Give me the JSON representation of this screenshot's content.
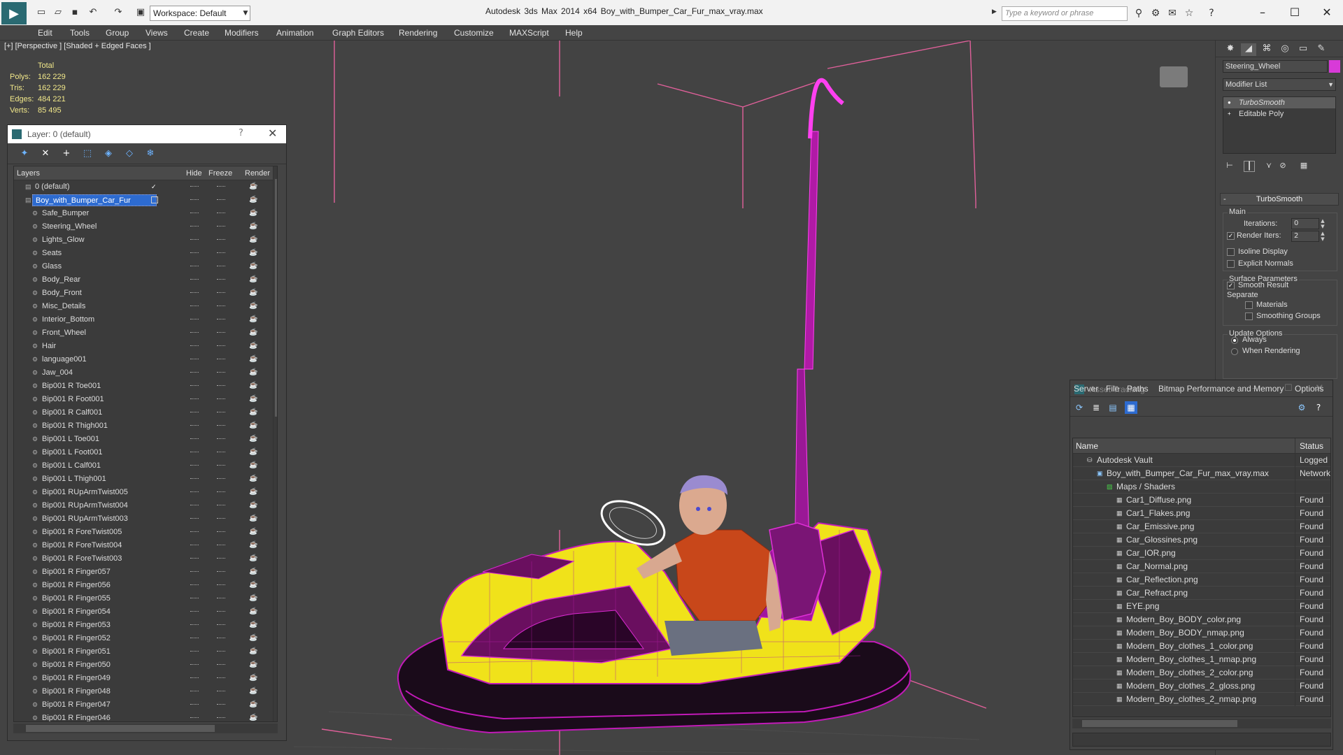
{
  "titlebar": {
    "workspace": "Workspace: Default",
    "title": "Autodesk 3ds Max  2014 x64     Boy_with_Bumper_Car_Fur_max_vray.max",
    "search_placeholder": "Type a keyword or phrase"
  },
  "menu": [
    "Edit",
    "Tools",
    "Group",
    "Views",
    "Create",
    "Modifiers",
    "Animation",
    "Graph Editors",
    "Rendering",
    "Customize",
    "MAXScript",
    "Help"
  ],
  "viewport": {
    "label": "[+] [Perspective ] [Shaded + Edged Faces ]",
    "stats": {
      "header": "Total",
      "rows": [
        {
          "label": "Polys:",
          "value": "162 229"
        },
        {
          "label": "Tris:",
          "value": "162 229"
        },
        {
          "label": "Edges:",
          "value": "484 221"
        },
        {
          "label": "Verts:",
          "value": "85 495"
        }
      ]
    }
  },
  "layers": {
    "title": "Layer: 0 (default)",
    "help": "?",
    "columns": {
      "name": "Layers",
      "hide": "Hide",
      "freeze": "Freeze",
      "render": "Render"
    },
    "items": [
      {
        "name": "0 (default)",
        "level": 0
      },
      {
        "name": "Boy_with_Bumper_Car_Fur",
        "level": 0
      },
      {
        "name": "Safe_Bumper",
        "level": 1
      },
      {
        "name": "Steering_Wheel",
        "level": 1
      },
      {
        "name": "Lights_Glow",
        "level": 1
      },
      {
        "name": "Seats",
        "level": 1
      },
      {
        "name": "Glass",
        "level": 1
      },
      {
        "name": "Body_Rear",
        "level": 1
      },
      {
        "name": "Body_Front",
        "level": 1
      },
      {
        "name": "Misc_Details",
        "level": 1
      },
      {
        "name": "Interior_Bottom",
        "level": 1
      },
      {
        "name": "Front_Wheel",
        "level": 1
      },
      {
        "name": "Hair",
        "level": 1
      },
      {
        "name": "language001",
        "level": 1
      },
      {
        "name": "Jaw_004",
        "level": 1
      },
      {
        "name": "Bip001 R Toe001",
        "level": 1
      },
      {
        "name": "Bip001 R Foot001",
        "level": 1
      },
      {
        "name": "Bip001 R Calf001",
        "level": 1
      },
      {
        "name": "Bip001 R Thigh001",
        "level": 1
      },
      {
        "name": "Bip001 L Toe001",
        "level": 1
      },
      {
        "name": "Bip001 L Foot001",
        "level": 1
      },
      {
        "name": "Bip001 L Calf001",
        "level": 1
      },
      {
        "name": "Bip001 L Thigh001",
        "level": 1
      },
      {
        "name": "Bip001 RUpArmTwist005",
        "level": 1
      },
      {
        "name": "Bip001 RUpArmTwist004",
        "level": 1
      },
      {
        "name": "Bip001 RUpArmTwist003",
        "level": 1
      },
      {
        "name": "Bip001 R ForeTwist005",
        "level": 1
      },
      {
        "name": "Bip001 R ForeTwist004",
        "level": 1
      },
      {
        "name": "Bip001 R ForeTwist003",
        "level": 1
      },
      {
        "name": "Bip001 R Finger057",
        "level": 1
      },
      {
        "name": "Bip001 R Finger056",
        "level": 1
      },
      {
        "name": "Bip001 R Finger055",
        "level": 1
      },
      {
        "name": "Bip001 R Finger054",
        "level": 1
      },
      {
        "name": "Bip001 R Finger053",
        "level": 1
      },
      {
        "name": "Bip001 R Finger052",
        "level": 1
      },
      {
        "name": "Bip001 R Finger051",
        "level": 1
      },
      {
        "name": "Bip001 R Finger050",
        "level": 1
      },
      {
        "name": "Bip001 R Finger049",
        "level": 1
      },
      {
        "name": "Bip001 R Finger048",
        "level": 1
      },
      {
        "name": "Bip001 R Finger047",
        "level": 1
      },
      {
        "name": "Bip001 R Finger046",
        "level": 1
      }
    ]
  },
  "command_panel": {
    "object_name": "Steering_Wheel",
    "object_color": "#d83ad8",
    "modifier_list": "Modifier List",
    "stack": [
      "TurboSmooth",
      "Editable Poly"
    ],
    "rollout": "TurboSmooth",
    "main_group": "Main",
    "iterations_label": "Iterations:",
    "iterations_value": "0",
    "render_iters_label": "Render Iters:",
    "render_iters_value": "2",
    "isoline": "Isoline Display",
    "explicit_normals": "Explicit Normals",
    "surface_group": "Surface Parameters",
    "smooth_result": "Smooth Result",
    "separate": "Separate",
    "materials": "Materials",
    "smoothing_groups": "Smoothing Groups",
    "update_group": "Update Options",
    "always": "Always",
    "when_rendering": "When Rendering"
  },
  "asset_tracking": {
    "title": "Asset Tracking",
    "menu": [
      "Server",
      "File",
      "Paths",
      "Bitmap Performance and Memory",
      "Options"
    ],
    "columns": {
      "name": "Name",
      "status": "Status"
    },
    "rows": [
      {
        "name": "Autodesk Vault",
        "status": "Logged O",
        "level": 0,
        "icon": "vault-icon"
      },
      {
        "name": "Boy_with_Bumper_Car_Fur_max_vray.max",
        "status": "Network",
        "level": 1,
        "icon": "max-file-icon"
      },
      {
        "name": "Maps / Shaders",
        "status": "",
        "level": 2,
        "icon": "maps-icon"
      },
      {
        "name": "Car1_Diffuse.png",
        "status": "Found",
        "level": 3,
        "icon": "bitmap-icon"
      },
      {
        "name": "Car1_Flakes.png",
        "status": "Found",
        "level": 3,
        "icon": "bitmap-icon"
      },
      {
        "name": "Car_Emissive.png",
        "status": "Found",
        "level": 3,
        "icon": "bitmap-icon"
      },
      {
        "name": "Car_Glossines.png",
        "status": "Found",
        "level": 3,
        "icon": "bitmap-icon"
      },
      {
        "name": "Car_IOR.png",
        "status": "Found",
        "level": 3,
        "icon": "bitmap-icon"
      },
      {
        "name": "Car_Normal.png",
        "status": "Found",
        "level": 3,
        "icon": "bitmap-icon"
      },
      {
        "name": "Car_Reflection.png",
        "status": "Found",
        "level": 3,
        "icon": "bitmap-icon"
      },
      {
        "name": "Car_Refract.png",
        "status": "Found",
        "level": 3,
        "icon": "bitmap-icon"
      },
      {
        "name": "EYE.png",
        "status": "Found",
        "level": 3,
        "icon": "bitmap-icon"
      },
      {
        "name": "Modern_Boy_BODY_color.png",
        "status": "Found",
        "level": 3,
        "icon": "bitmap-icon"
      },
      {
        "name": "Modern_Boy_BODY_nmap.png",
        "status": "Found",
        "level": 3,
        "icon": "bitmap-icon"
      },
      {
        "name": "Modern_Boy_clothes_1_color.png",
        "status": "Found",
        "level": 3,
        "icon": "bitmap-icon"
      },
      {
        "name": "Modern_Boy_clothes_1_nmap.png",
        "status": "Found",
        "level": 3,
        "icon": "bitmap-icon"
      },
      {
        "name": "Modern_Boy_clothes_2_color.png",
        "status": "Found",
        "level": 3,
        "icon": "bitmap-icon"
      },
      {
        "name": "Modern_Boy_clothes_2_gloss.png",
        "status": "Found",
        "level": 3,
        "icon": "bitmap-icon"
      },
      {
        "name": "Modern_Boy_clothes_2_nmap.png",
        "status": "Found",
        "level": 3,
        "icon": "bitmap-icon"
      }
    ]
  },
  "colors": {
    "selection": "#2d6bd0",
    "stats": "#f2e88a",
    "car_yellow": "#f0e21a",
    "wire_magenta": "#c21ab8"
  }
}
